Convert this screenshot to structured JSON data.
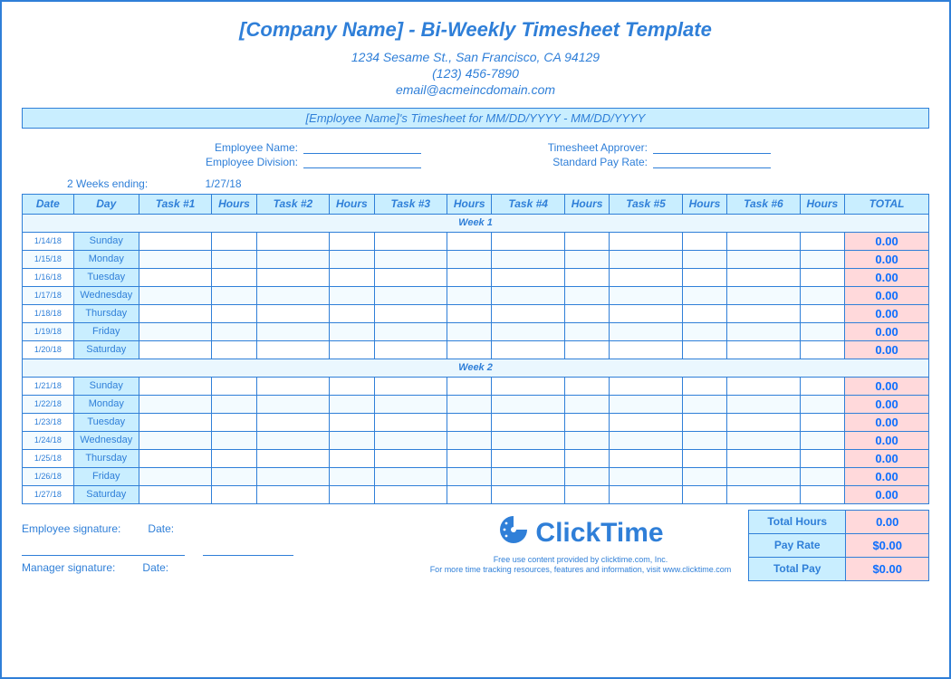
{
  "title": "[Company Name] - Bi-Weekly Timesheet Template",
  "address_line1": "1234 Sesame St.,  San Francisco, CA 94129",
  "address_line2": "(123) 456-7890",
  "address_line3": "email@acmeincdomain.com",
  "banner": "[Employee Name]'s Timesheet for MM/DD/YYYY - MM/DD/YYYY",
  "labels": {
    "emp_name": "Employee Name:",
    "emp_div": "Employee Division:",
    "approver": "Timesheet Approver:",
    "pay_rate": "Standard Pay Rate:",
    "ending": "2 Weeks ending:",
    "emp_sig": "Employee signature:",
    "mgr_sig": "Manager signature:",
    "date": "Date:"
  },
  "ending_date": "1/27/18",
  "columns": [
    "Date",
    "Day",
    "Task #1",
    "Hours",
    "Task #2",
    "Hours",
    "Task #3",
    "Hours",
    "Task #4",
    "Hours",
    "Task #5",
    "Hours",
    "Task #6",
    "Hours",
    "TOTAL"
  ],
  "week1_label": "Week 1",
  "week2_label": "Week 2",
  "week1": [
    {
      "date": "1/14/18",
      "day": "Sunday",
      "total": "0.00"
    },
    {
      "date": "1/15/18",
      "day": "Monday",
      "total": "0.00"
    },
    {
      "date": "1/16/18",
      "day": "Tuesday",
      "total": "0.00"
    },
    {
      "date": "1/17/18",
      "day": "Wednesday",
      "total": "0.00"
    },
    {
      "date": "1/18/18",
      "day": "Thursday",
      "total": "0.00"
    },
    {
      "date": "1/19/18",
      "day": "Friday",
      "total": "0.00"
    },
    {
      "date": "1/20/18",
      "day": "Saturday",
      "total": "0.00"
    }
  ],
  "week2": [
    {
      "date": "1/21/18",
      "day": "Sunday",
      "total": "0.00"
    },
    {
      "date": "1/22/18",
      "day": "Monday",
      "total": "0.00"
    },
    {
      "date": "1/23/18",
      "day": "Tuesday",
      "total": "0.00"
    },
    {
      "date": "1/24/18",
      "day": "Wednesday",
      "total": "0.00"
    },
    {
      "date": "1/25/18",
      "day": "Thursday",
      "total": "0.00"
    },
    {
      "date": "1/26/18",
      "day": "Friday",
      "total": "0.00"
    },
    {
      "date": "1/27/18",
      "day": "Saturday",
      "total": "0.00"
    }
  ],
  "summary": {
    "total_hours_label": "Total Hours",
    "total_hours_value": "0.00",
    "pay_rate_label": "Pay Rate",
    "pay_rate_value": "$0.00",
    "total_pay_label": "Total Pay",
    "total_pay_value": "$0.00"
  },
  "brand": "ClickTime",
  "fine1": "Free use content provided by clicktime.com, Inc.",
  "fine2": "For more time tracking resources, features and information, visit www.clicktime.com"
}
